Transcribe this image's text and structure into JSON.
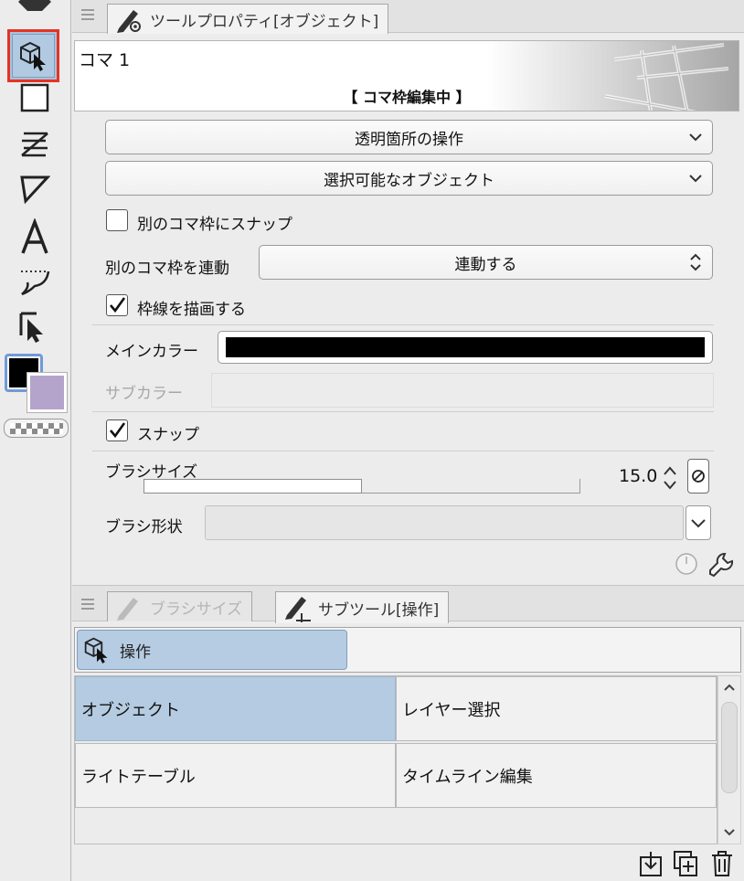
{
  "toolbar": {
    "tools": [
      "move-tool",
      "operation-tool",
      "rectangle-frame-tool",
      "ruler-tool",
      "figure-tool",
      "text-tool",
      "balloon-tool",
      "correction-line-tool"
    ],
    "main_color": "#000000",
    "sub_color": "#b4a4cc"
  },
  "tool_property": {
    "tab_label": "ツールプロパティ[オブジェクト]",
    "preview_title": "コマ 1",
    "preview_status": "【 コマ枠編集中 】",
    "transparent_op": "透明箇所の操作",
    "selectable_objects": "選択可能なオブジェクト",
    "snap_other_frame": "別のコマ枠にスナップ",
    "link_other_frame_label": "別のコマ枠を連動",
    "link_other_frame_value": "連動する",
    "draw_border": "枠線を描画する",
    "main_color_label": "メインカラー",
    "main_color_value": "#000000",
    "sub_color_label": "サブカラー",
    "snap": "スナップ",
    "brush_size_label": "ブラシサイズ",
    "brush_size_value": "15.0",
    "brush_size_fraction": 0.5,
    "brush_shape_label": "ブラシ形状",
    "brush_shape_value": ""
  },
  "subtool": {
    "tabs": [
      "ブラシサイズ",
      "サブツール[操作]"
    ],
    "group_label": "操作",
    "items": [
      {
        "label": "オブジェクト",
        "selected": true
      },
      {
        "label": "レイヤー選択",
        "selected": false
      },
      {
        "label": "ライトテーブル",
        "selected": false
      },
      {
        "label": "タイムライン編集",
        "selected": false
      }
    ]
  }
}
